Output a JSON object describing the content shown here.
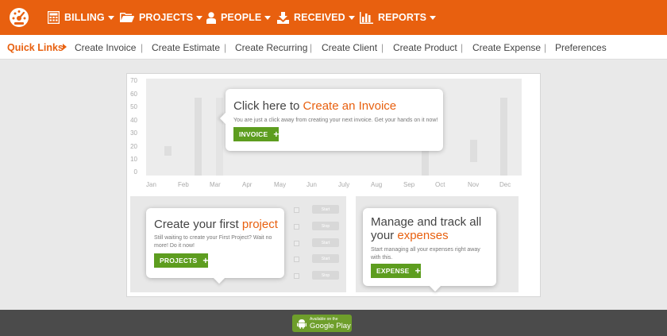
{
  "nav": {
    "items": [
      {
        "label": "BILLING",
        "icon": "calculator-icon"
      },
      {
        "label": "PROJECTS",
        "icon": "folder-icon"
      },
      {
        "label": "PEOPLE",
        "icon": "person-icon"
      },
      {
        "label": "RECEIVED",
        "icon": "download-icon"
      },
      {
        "label": "REPORTS",
        "icon": "bar-chart-icon"
      }
    ],
    "logo_icon": "dashboard-gauge-icon",
    "accent": "#e8600f"
  },
  "quick_links": {
    "title": "Quick Links",
    "links": [
      "Create Invoice",
      "Create Estimate",
      "Create Recurring",
      "Create Client",
      "Create Product",
      "Create Expense",
      "Preferences"
    ]
  },
  "chart": {
    "y_ticks": [
      "70",
      "60",
      "50",
      "40",
      "30",
      "20",
      "10",
      "0"
    ],
    "x_ticks": [
      "Jan",
      "Feb",
      "Mar",
      "Apr",
      "May",
      "Jun",
      "July",
      "Aug",
      "Sep",
      "Oct",
      "Nov",
      "Dec"
    ]
  },
  "invoice_card": {
    "title_prefix": "Click here to ",
    "title_highlight": "Create an Invoice",
    "text": "You are just a click away from creating your next invoice. Get your hands on it now!",
    "button": "INVOICE"
  },
  "project_card": {
    "title_prefix": "Create your first ",
    "title_highlight": "project",
    "text": "Still waiting to create your First Project? Wait no more! Do it now!",
    "button": "PROJECTS",
    "ghost_buttons": [
      "Start",
      "Stop",
      "Start",
      "Start",
      "Stop"
    ]
  },
  "expense_card": {
    "title_line1": "Manage and track all",
    "title_prefix": "your ",
    "title_highlight": "expenses",
    "text": "Start managing all your expenses right away with this.",
    "button": "EXPENSE"
  },
  "footer": {
    "store_small": "Available on the",
    "store_big": "Google Play",
    "store_icon": "android-icon"
  }
}
